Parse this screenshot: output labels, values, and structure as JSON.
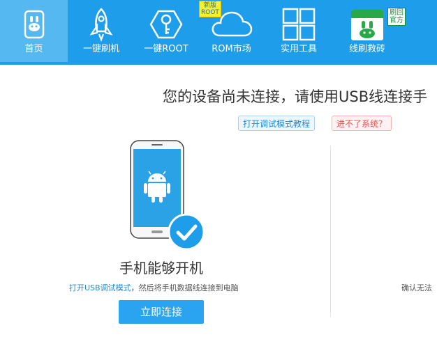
{
  "nav": {
    "items": [
      {
        "label": "首页",
        "icon": "home-rabbit-icon",
        "active": true
      },
      {
        "label": "一键刷机",
        "icon": "rocket-icon"
      },
      {
        "label": "一键ROOT",
        "icon": "key-hexagon-icon"
      },
      {
        "label": "ROM市场",
        "icon": "cloud-icon"
      },
      {
        "label": "实用工具",
        "icon": "grid-icon"
      },
      {
        "label": "线刷救砖",
        "icon": "rabbit-calendar-icon"
      }
    ],
    "badge_new_line1": "新版",
    "badge_new_line2": "ROOT",
    "badge_official_line1": "刷回",
    "badge_official_line2": "官方"
  },
  "main": {
    "headline": "您的设备尚未连接，请使用USB线连接手",
    "tutorial_link": "打开调试模式教程",
    "cant_enter_link": "进不了系统？",
    "left_panel": {
      "title": "手机能够开机",
      "hint_link": "打开USB调试模式",
      "hint_rest": "，然后将手机数据线连接到电脑",
      "button": "立即连接"
    },
    "right_panel": {
      "hint_partial": "确认无法"
    }
  },
  "colors": {
    "topbar": "#1e9eea",
    "active_tab": "#56b8f0",
    "primary": "#2aa3f0",
    "link": "#1e8ad6",
    "warning": "#e65050"
  }
}
